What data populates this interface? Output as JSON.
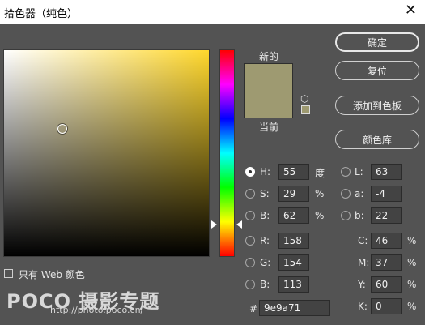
{
  "window": {
    "title": "拾色器（纯色）",
    "close_symbol": "✕"
  },
  "labels": {
    "new": "新的",
    "current": "当前"
  },
  "colors": {
    "new": "#9e9a71",
    "current": "#9e9a71"
  },
  "buttons": {
    "ok": "确定",
    "reset": "复位",
    "add_to_swatches": "添加到色板",
    "color_libraries": "颜色库"
  },
  "fields": {
    "H": {
      "label": "H:",
      "value": "55",
      "unit": "度",
      "selected": true
    },
    "S": {
      "label": "S:",
      "value": "29",
      "unit": "%"
    },
    "B": {
      "label": "B:",
      "value": "62",
      "unit": "%"
    },
    "R": {
      "label": "R:",
      "value": "158"
    },
    "G": {
      "label": "G:",
      "value": "154"
    },
    "Bl": {
      "label": "B:",
      "value": "113"
    },
    "L": {
      "label": "L:",
      "value": "63"
    },
    "a": {
      "label": "a:",
      "value": "-4"
    },
    "b": {
      "label": "b:",
      "value": "22"
    },
    "C": {
      "label": "C:",
      "value": "46",
      "unit": "%"
    },
    "M": {
      "label": "M:",
      "value": "37",
      "unit": "%"
    },
    "Y": {
      "label": "Y:",
      "value": "60",
      "unit": "%"
    },
    "K": {
      "label": "K:",
      "value": "0",
      "unit": "%"
    }
  },
  "hex": {
    "label": "#",
    "value": "9e9a71"
  },
  "web_only": {
    "label": "只有 Web 颜色",
    "checked": false
  },
  "watermark": {
    "brand": "POCO 摄影专题",
    "url": "http://photo.poco.cn/"
  }
}
